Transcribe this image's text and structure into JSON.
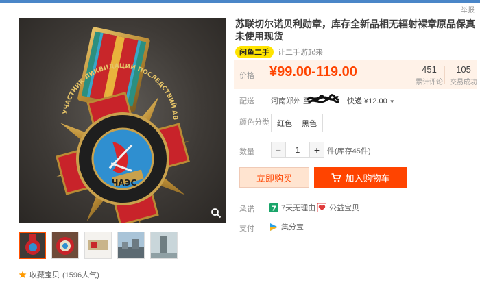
{
  "header": {
    "report_label": "举报"
  },
  "product": {
    "title": "苏联切尔诺贝利勋章，库存全新品相无辐射裸章原品保真未使用现货",
    "xianyu_logo": "闲鱼二手",
    "xianyu_text": "让二手游起来",
    "price_label": "价格",
    "price": "¥99.00-119.00",
    "stats": [
      {
        "value": "451",
        "label": "累计评论"
      },
      {
        "value": "105",
        "label": "交易成功"
      }
    ],
    "shipping": {
      "label": "配送",
      "from": "河南郑州 至",
      "method": "快递 ¥12.00"
    },
    "color": {
      "label": "颜色分类",
      "options": [
        "红色",
        "黑色"
      ]
    },
    "quantity": {
      "label": "数量",
      "minus": "−",
      "value": "1",
      "plus": "+",
      "stock": "件(库存45件)"
    },
    "buttons": {
      "buy": "立即购买",
      "cart": "加入购物车"
    },
    "promise": {
      "label": "承诺",
      "items": [
        "7天无理由",
        "公益宝贝"
      ]
    },
    "payment": {
      "label": "支付",
      "method": "集分宝"
    }
  },
  "gallery": {
    "favorite": "收藏宝贝",
    "popularity": "(1596人气)"
  },
  "medal_text": {
    "ring": "УЧАСТНИК ЛИКВИДАЦИИ ПОСЛЕДСТВИЙ АВАРИИ",
    "center": "ЧАЭС"
  },
  "colors": {
    "accent": "#ff4400",
    "price_bg": "#fff2e8",
    "xianyu": "#ffe400"
  }
}
